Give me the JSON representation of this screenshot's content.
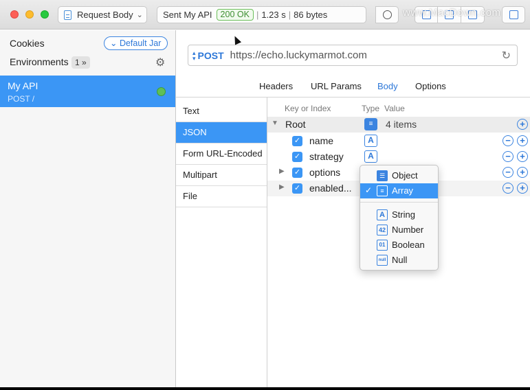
{
  "titlebar": {
    "request_body_label": "Request Body",
    "status_prefix": "Sent My API",
    "status_code": "200 OK",
    "status_time": "1.23 s",
    "status_size": "86 bytes",
    "watermark": "www.MacDown.com"
  },
  "sidebar": {
    "cookies_label": "Cookies",
    "jar_button": "Default Jar",
    "environments_label": "Environments",
    "environments_count": "1 »",
    "api": {
      "name": "My API",
      "subtitle": "POST /"
    }
  },
  "request": {
    "method": "POST",
    "url": "https://echo.luckymarmot.com"
  },
  "tabs": [
    "Headers",
    "URL Params",
    "Body",
    "Options"
  ],
  "active_tab": "Body",
  "body_types": [
    "Text",
    "JSON",
    "Form URL-Encoded",
    "Multipart",
    "File"
  ],
  "active_body_type": "JSON",
  "editor": {
    "headers": {
      "key": "Key or Index",
      "type": "Type",
      "value": "Value"
    },
    "root": {
      "key": "Root",
      "type_icon": "array-icon",
      "value": "4 items"
    },
    "rows": [
      {
        "key": "name",
        "checked": true,
        "type_icon": "string-icon",
        "type_glyph": "A",
        "expandable": false
      },
      {
        "key": "strategy",
        "checked": true,
        "type_icon": "string-icon",
        "type_glyph": "A",
        "expandable": false
      },
      {
        "key": "options",
        "checked": true,
        "type_icon": "object-icon",
        "type_glyph": "",
        "expandable": true
      },
      {
        "key": "enabled...",
        "checked": true,
        "type_icon": "array-icon",
        "type_glyph": "",
        "expandable": true
      }
    ]
  },
  "type_menu": {
    "items": [
      {
        "label": "Object",
        "icon": "object-icon",
        "glyph": "☰",
        "selected": false
      },
      {
        "label": "Array",
        "icon": "array-icon",
        "glyph": "≡",
        "selected": true
      },
      {
        "label": "String",
        "icon": "string-icon",
        "glyph": "A",
        "selected": false
      },
      {
        "label": "Number",
        "icon": "number-icon",
        "glyph": "42",
        "selected": false
      },
      {
        "label": "Boolean",
        "icon": "boolean-icon",
        "glyph": "01",
        "selected": false
      },
      {
        "label": "Null",
        "icon": "null-icon",
        "glyph": "null",
        "selected": false
      }
    ]
  },
  "colors": {
    "accent": "#3b96f5",
    "status_ok": "#3f8f33",
    "link": "#2c77d8"
  }
}
